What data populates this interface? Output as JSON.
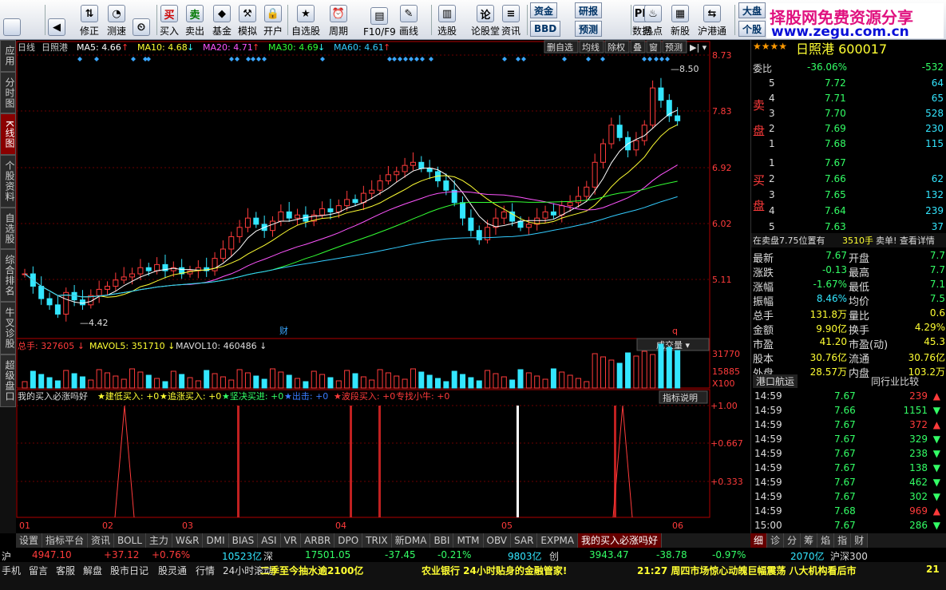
{
  "toolbar": {
    "buttons": [
      {
        "label": "",
        "icon": "logo-icon"
      },
      {
        "label": "",
        "icon": "back-arrow-icon"
      },
      {
        "label": "修正",
        "icon": "up-down-icon"
      },
      {
        "label": "测速",
        "icon": "speed-icon"
      },
      {
        "label": "",
        "icon": "clock-icon"
      },
      {
        "label": "买入",
        "icon": "buy-icon"
      },
      {
        "label": "卖出",
        "icon": "sell-icon"
      },
      {
        "label": "基金",
        "icon": "fund-icon"
      },
      {
        "label": "模拟",
        "icon": "hammer-icon"
      },
      {
        "label": "开户",
        "icon": "lock-icon"
      },
      {
        "label": "自选股",
        "icon": "star-icon"
      },
      {
        "label": "周期",
        "icon": "period-icon"
      },
      {
        "label": "F10/F9",
        "icon": "f10-icon"
      },
      {
        "label": "画线",
        "icon": "pen-icon"
      },
      {
        "label": "选股",
        "icon": "pick-icon"
      },
      {
        "label": "论股堂",
        "icon": "forum-icon"
      },
      {
        "label": "资讯",
        "icon": "news-icon"
      },
      {
        "label": "资金",
        "icon": "money-icon"
      },
      {
        "label": "BBD",
        "icon": "bbd-icon"
      },
      {
        "label": "研报",
        "icon": "report-icon"
      },
      {
        "label": "预测",
        "icon": "forecast-icon"
      },
      {
        "label": "数据",
        "icon": "pe-icon"
      },
      {
        "label": "热点",
        "icon": "hot-icon"
      },
      {
        "label": "新股",
        "icon": "newstock-icon"
      },
      {
        "label": "沪港通",
        "icon": "shhk-icon"
      },
      {
        "label": "大盘",
        "icon": "index-icon"
      },
      {
        "label": "个股",
        "icon": "stock-icon"
      }
    ],
    "watermark1": "择股网免费资源分享",
    "watermark2": "www.zegu.com.cn"
  },
  "sidebar": [
    "应用",
    "分时图",
    "K线图",
    "个股资料",
    "自选股",
    "综合排名",
    "牛叉诊股",
    "超级盘口"
  ],
  "chart": {
    "period": "日线",
    "name": "日照港",
    "ma": [
      {
        "t": "MA5: 4.66",
        "c": "#ffffff",
        "a": "↑",
        "ac": "#ff3333"
      },
      {
        "t": "MA10: 4.68",
        "c": "#ffff33",
        "a": "↓",
        "ac": "#33ffff"
      },
      {
        "t": "MA20: 4.71",
        "c": "#ff55ff",
        "a": "↑",
        "ac": "#ff3333"
      },
      {
        "t": "MA30: 4.69",
        "c": "#33ff33",
        "a": "↓",
        "ac": "#33ffff"
      },
      {
        "t": "MA60: 4.61",
        "c": "#33ccff",
        "a": "↑",
        "ac": "#ff3333"
      }
    ],
    "btns": [
      "删自选",
      "均线",
      "除权",
      "叠",
      "窗",
      "预测"
    ],
    "yticks": [
      "8.73",
      "7.83",
      "6.92",
      "6.02",
      "5.11"
    ],
    "high": "8.50",
    "low": "4.42",
    "cai": "财",
    "q": "q",
    "vol": {
      "total": "总手: 327605",
      "t1": "MAVOL5: 351710",
      "t2": "MAVOL10: 460486",
      "yt": [
        "31770",
        "15885",
        "X100"
      ],
      "sel": "成交量"
    },
    "ind": {
      "name": "我的买入必涨吗好",
      "items": [
        "★建低买入: +0",
        "★追涨买入: +0",
        "★坚决买进: +0",
        "★出击: +0",
        "★波段买入: +0",
        "专找小牛: +0"
      ],
      "btn": "指标说明",
      "yt": [
        "+1.00",
        "+0.667",
        "+0.333"
      ]
    },
    "dates": [
      "01",
      "02",
      "03",
      "04",
      "05",
      "06"
    ]
  },
  "quote": {
    "stars": "★★★★",
    "stock": "日照港 600017",
    "weibi": "委比",
    "wbv": "-36.06%",
    "wbn": "-532",
    "sell": "卖盘",
    "buy": "买盘",
    "asks": [
      [
        "5",
        "7.72",
        "64"
      ],
      [
        "4",
        "7.71",
        "65"
      ],
      [
        "3",
        "7.70",
        "528"
      ],
      [
        "2",
        "7.69",
        "230"
      ],
      [
        "1",
        "7.68",
        "115"
      ]
    ],
    "bids": [
      [
        "1",
        "7.67",
        ""
      ],
      [
        "2",
        "7.66",
        "62"
      ],
      [
        "3",
        "7.65",
        "132"
      ],
      [
        "4",
        "7.64",
        "239"
      ],
      [
        "5",
        "7.63",
        "37"
      ]
    ],
    "notice1": "在卖盘7.75位置有",
    "notice2": "3510手",
    "notice3": "卖单! 查看详情",
    "stats": [
      [
        "最新",
        "7.67",
        "开盘",
        "7.7"
      ],
      [
        "涨跌",
        "-0.13",
        "最高",
        "7.7"
      ],
      [
        "涨幅",
        "-1.67%",
        "最低",
        "7.1"
      ],
      [
        "振幅",
        "8.46%",
        "均价",
        "7.5"
      ],
      [
        "总手",
        "131.8万",
        "量比",
        "0.6"
      ],
      [
        "金额",
        "9.90亿",
        "换手",
        "4.29%"
      ],
      [
        "市盈",
        "41.20",
        "市盈(动)",
        "45.3"
      ],
      [
        "股本",
        "30.76亿",
        "流通",
        "30.76亿"
      ],
      [
        "外盘",
        "28.57万",
        "内盘",
        "103.2万"
      ]
    ],
    "tab1": "港口航运",
    "tab2": "同行业比较",
    "ticks": [
      [
        "14:59",
        "7.67",
        "239",
        "u"
      ],
      [
        "14:59",
        "7.66",
        "1151",
        "d"
      ],
      [
        "14:59",
        "7.67",
        "372",
        "u"
      ],
      [
        "14:59",
        "7.67",
        "329",
        "d"
      ],
      [
        "14:59",
        "7.67",
        "238",
        "d"
      ],
      [
        "14:59",
        "7.67",
        "138",
        "d"
      ],
      [
        "14:59",
        "7.67",
        "462",
        "d"
      ],
      [
        "14:59",
        "7.67",
        "302",
        "d"
      ],
      [
        "14:59",
        "7.68",
        "969",
        "u"
      ],
      [
        "15:00",
        "7.67",
        "286",
        "d"
      ]
    ],
    "rtabs": [
      "细",
      "诊",
      "分",
      "筹",
      "焰",
      "指",
      "财"
    ]
  },
  "bottomtabs": [
    "设置",
    "指标平台",
    "资讯",
    "BOLL",
    "主力",
    "W&R",
    "DMI",
    "BIAS",
    "ASI",
    "VR",
    "ARBR",
    "DPO",
    "TRIX",
    "新DMA",
    "BBI",
    "MTM",
    "OBV",
    "SAR",
    "EXPMA",
    "我的买入必涨吗好"
  ],
  "ticker": {
    "sh": "沪",
    "shv": "4947.10",
    "shc": "+37.12",
    "shp": "+0.76%",
    "sha": "10523亿",
    "sz": "深",
    "szv": "17501.05",
    "szc": "-37.45",
    "szp": "-0.21%",
    "sza": "9803亿",
    "cy": "创",
    "cyv": "3943.47",
    "cyc": "-38.78",
    "cyp": "-0.97%",
    "cya": "2070亿",
    "hs": "沪深300"
  },
  "status": {
    "items": [
      "手机",
      "留言",
      "客服",
      "解盘",
      "股市日记",
      "股灵通",
      "行情",
      "24小时滚动"
    ],
    "news1": "二季至今抽水逾2100亿",
    "news2": "农业银行 24小时贴身的金融管家!",
    "news3": "21:27 周四市场惊心动魄巨幅震荡 八大机构看后市",
    "news4": "21"
  }
}
